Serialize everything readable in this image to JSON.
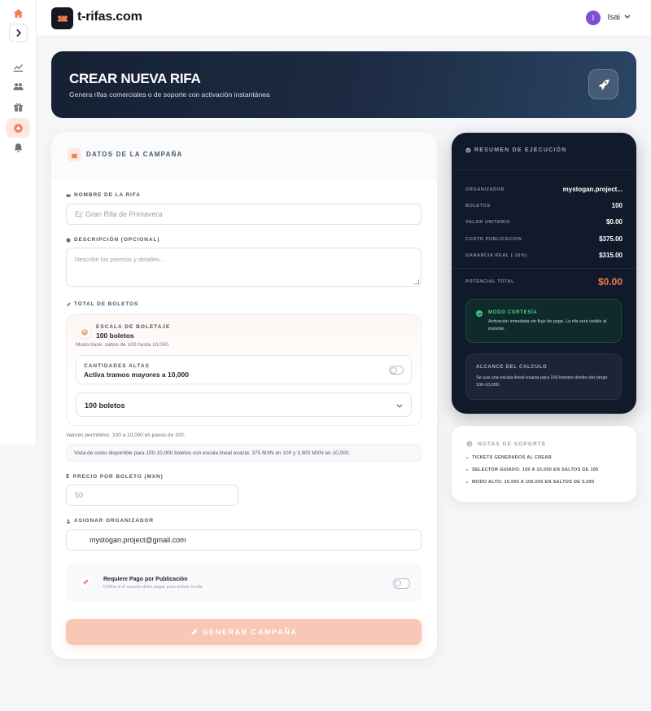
{
  "colors": {
    "accent": "#f07a55",
    "accent_soft": "#f8c7b5",
    "dark_panel": "#111a2a",
    "success": "#34c77b",
    "avatar": "#7c4fd6"
  },
  "sidebar": {
    "items": [
      {
        "icon": "home-icon"
      },
      {
        "icon": "chevron-right-icon"
      },
      {
        "icon": "chart-icon"
      },
      {
        "icon": "users-icon"
      },
      {
        "icon": "gift-icon"
      },
      {
        "icon": "plus-circle-icon"
      },
      {
        "icon": "bell-icon"
      }
    ]
  },
  "header": {
    "brand": "t-rifas.com",
    "user_initial": "I",
    "user_name": "Isai"
  },
  "hero": {
    "title": "CREAR NUEVA RIFA",
    "subtitle": "Genera rifas comerciales o de soporte con activación instantánea"
  },
  "form": {
    "section_title": "DATOS DE LA CAMPAÑA",
    "name": {
      "label": "NOMBRE DE LA RIFA",
      "placeholder": "Ej: Gran Rifa de Primavera"
    },
    "description": {
      "label": "DESCRIPCIÓN (OPCIONAL)",
      "placeholder": "Describe los premios y detalles..."
    },
    "tickets": {
      "label": "TOTAL DE BOLETOS",
      "scale_label": "ESCALA DE BOLETAJE",
      "scale_value": "100 boletos",
      "scale_note": "Modo base: saltos de 100 hasta 10,000.",
      "high_label": "CANTIDADES ALTAS",
      "high_value": "Activa tramos mayores a 10,000",
      "high_enabled": false,
      "select_value": "100 boletos",
      "allowed": "Valores permitidos: 100 a 10,000 en pasos de 100.",
      "info": "Vista de costo disponible para 100-10,000 boletos con escala lineal exacta: 375 MXN en 100 y 3,900 MXN en 10,000."
    },
    "price": {
      "label": "PRECIO POR BOLETO (MXN)",
      "placeholder": "50"
    },
    "organizer": {
      "label": "ASIGNAR ORGANIZADOR",
      "value": "mystogan.project@gmail.com"
    },
    "payment": {
      "title": "Requiere Pago por Publicación",
      "subtitle": "Define si el usuario debe pagar para activar la rifa",
      "enabled": false
    },
    "submit_label": "GENERAR CAMPAÑA"
  },
  "summary": {
    "title": "RESUMEN DE EJECUCIÓN",
    "rows": [
      {
        "key": "ORGANIZADOR",
        "value": "mystogan.project..."
      },
      {
        "key": "BOLETOS",
        "value": "100"
      },
      {
        "key": "VALOR UNITARIO",
        "value": "$0.00"
      },
      {
        "key": "COSTO PUBLICACION",
        "value": "$375.00"
      },
      {
        "key": "GANANCIA REAL (-16%)",
        "value": "$315.00"
      }
    ],
    "total_key": "POTENCIAL TOTAL",
    "total_value": "$0.00",
    "courtesy_title": "MODO CORTESÍA",
    "courtesy_text": "Activación inmediata sin flujo de pago. La rifa será visible al instante.",
    "scope_title": "ALCANCE DEL CALCULO",
    "scope_text": "Se usa una escala lineal exacta para 100 boletos dentro del rango 100-10,000."
  },
  "notes": {
    "title": "NOTAS DE SOPORTE",
    "items": [
      "TICKETS GENERADOS AL CREAR",
      "SELECTOR GUIADO: 100 A 10,000 EN SALTOS DE 100",
      "MODO ALTO: 10,000 A 100,000 EN SALTOS DE 5,000"
    ]
  }
}
